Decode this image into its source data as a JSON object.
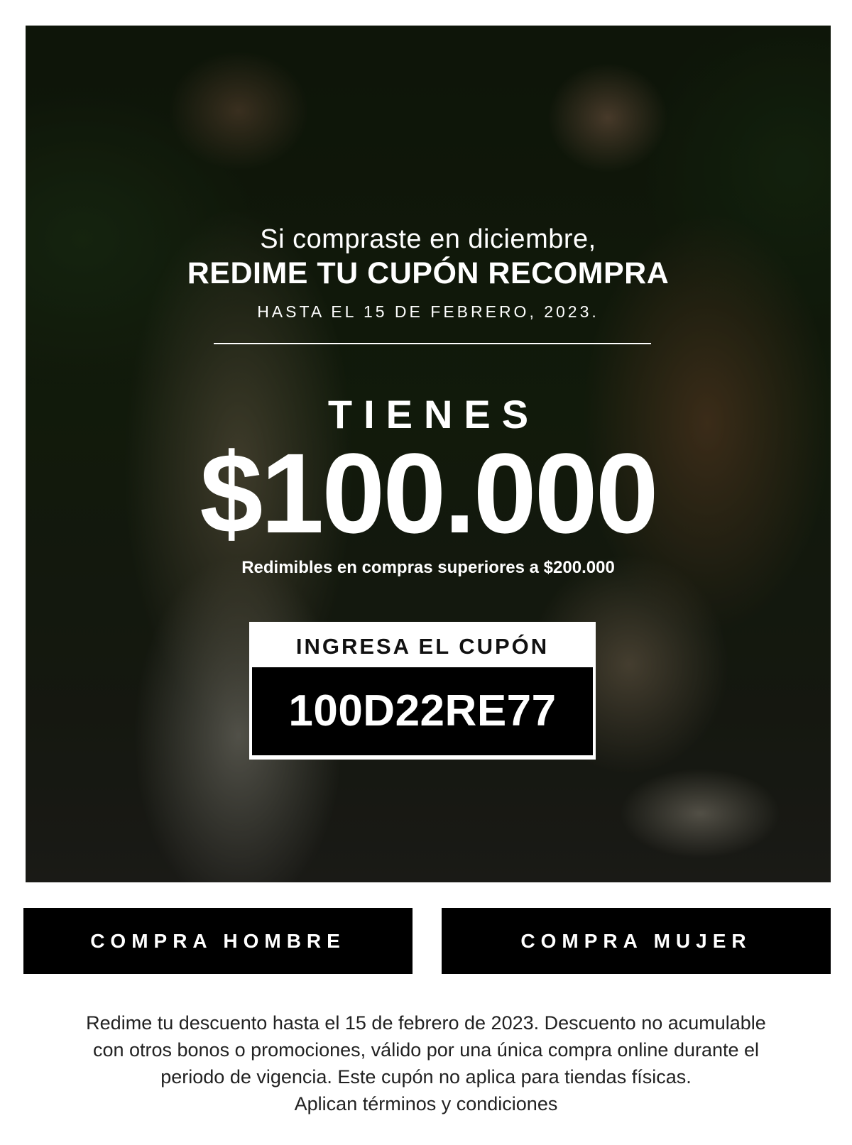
{
  "hero": {
    "intro": "Si compraste en diciembre,",
    "headline": "REDIME TU CUPÓN RECOMPRA",
    "deadline": "HASTA EL 15 DE FEBRERO, 2023.",
    "tienes": "TIENES",
    "amount": "$100.000",
    "amount_note": "Redimibles en compras superiores a $200.000"
  },
  "coupon": {
    "label": "INGRESA EL CUPÓN",
    "code": "100D22RE77"
  },
  "buttons": {
    "men": "COMPRA HOMBRE",
    "women": "COMPRA MUJER"
  },
  "legal": {
    "line1": "Redime tu descuento hasta el 15 de febrero de 2023. Descuento no acumulable",
    "line2": "con otros bonos o promociones, válido por una única compra online durante el",
    "line3": "periodo de vigencia. Este cupón no aplica para tiendas físicas.",
    "terms": "Aplican términos y condiciones"
  },
  "colors": {
    "button_bg": "#000000",
    "overlay_text": "#ffffff"
  }
}
